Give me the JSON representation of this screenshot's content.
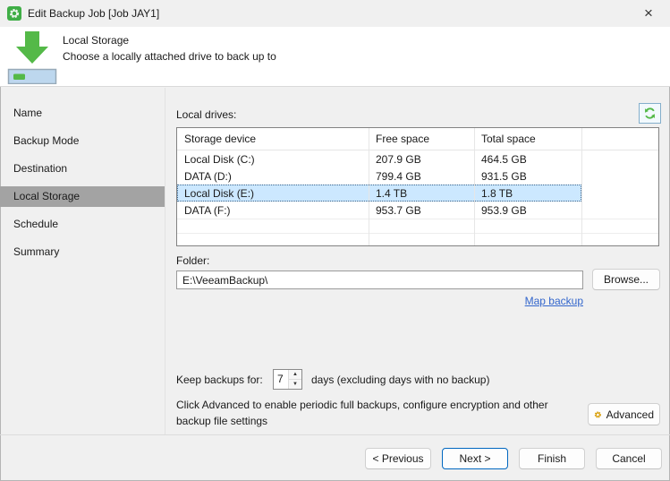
{
  "window": {
    "title": "Edit Backup Job [Job JAY1]",
    "close_glyph": "×"
  },
  "header": {
    "title": "Local Storage",
    "subtitle": "Choose a locally attached drive to back up to"
  },
  "sidebar": {
    "items": [
      "Name",
      "Backup Mode",
      "Destination",
      "Local Storage",
      "Schedule",
      "Summary"
    ],
    "selected": "Local Storage"
  },
  "drives": {
    "label": "Local drives:",
    "columns": [
      "Storage device",
      "Free space",
      "Total space"
    ],
    "rows": [
      {
        "device": "Local Disk (C:)",
        "free": "207.9 GB",
        "total": "464.5 GB"
      },
      {
        "device": "DATA (D:)",
        "free": "799.4 GB",
        "total": "931.5 GB"
      },
      {
        "device": "Local Disk (E:)",
        "free": "1.4 TB",
        "total": "1.8 TB"
      },
      {
        "device": "DATA (F:)",
        "free": "953.7 GB",
        "total": "953.9 GB"
      }
    ],
    "selected_row": "Local Disk (E:)"
  },
  "folder": {
    "label": "Folder:",
    "value": "E:\\VeeamBackup\\",
    "browse_label": "Browse...",
    "map_link": "Map backup"
  },
  "retention": {
    "label": "Keep backups for:",
    "value": "7",
    "suffix": "days (excluding days with no backup)"
  },
  "advanced": {
    "note_line1": "Click Advanced to enable periodic full backups, configure encryption and other",
    "note_line2": "backup file settings",
    "button_label": "Advanced"
  },
  "footer": {
    "previous": "< Previous",
    "next": "Next >",
    "finish": "Finish",
    "cancel": "Cancel"
  },
  "colors": {
    "accent_green": "#54b948",
    "selection_blue": "#cce8ff",
    "sidebar_selected_gray": "#a3a3a3",
    "link_blue": "#3366cc",
    "advanced_gear_gold": "#d79b00",
    "next_button_border": "#0067c0"
  }
}
